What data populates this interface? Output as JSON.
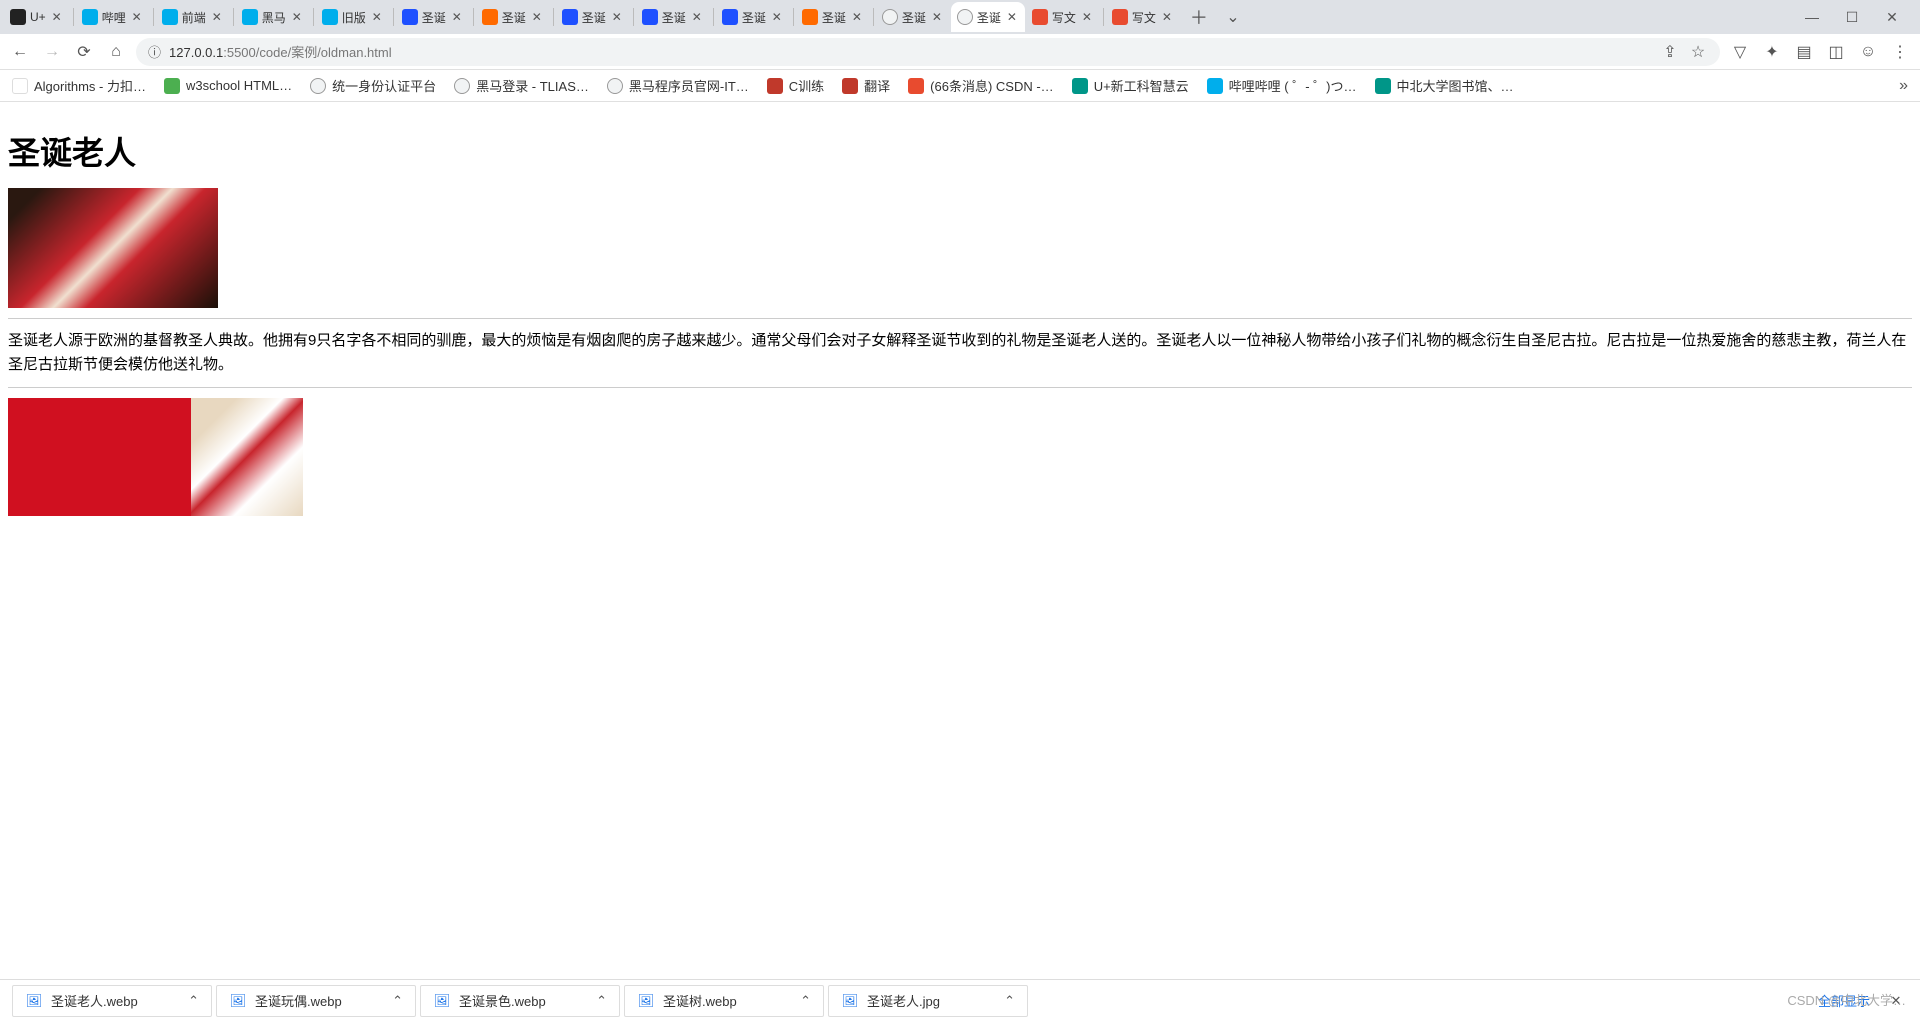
{
  "tabs": [
    {
      "title": "U+",
      "favcls": "fav-black"
    },
    {
      "title": "哔哩",
      "favcls": "fav-blue"
    },
    {
      "title": "前端",
      "favcls": "fav-blue"
    },
    {
      "title": "黑马",
      "favcls": "fav-blue"
    },
    {
      "title": "旧版",
      "favcls": "fav-blue"
    },
    {
      "title": "圣诞",
      "favcls": "fav-bluep"
    },
    {
      "title": "圣诞",
      "favcls": "fav-orange"
    },
    {
      "title": "圣诞",
      "favcls": "fav-bluep"
    },
    {
      "title": "圣诞",
      "favcls": "fav-bluep"
    },
    {
      "title": "圣诞",
      "favcls": "fav-bluep"
    },
    {
      "title": "圣诞",
      "favcls": "fav-orange"
    },
    {
      "title": "圣诞",
      "favcls": "fav-globe"
    },
    {
      "title": "圣诞",
      "favcls": "fav-globe",
      "active": true
    },
    {
      "title": "写文",
      "favcls": "fav-red"
    },
    {
      "title": "写文",
      "favcls": "fav-red"
    }
  ],
  "url": {
    "info_icon": "ⓘ",
    "host": "127.0.0.1",
    "port": ":5500",
    "path": "/code/案例/oldman.html"
  },
  "bookmarks": [
    {
      "label": "Algorithms - 力扣…",
      "favcls": "fav-leet"
    },
    {
      "label": "w3school HTML…",
      "favcls": "fav-green"
    },
    {
      "label": "统一身份认证平台",
      "favcls": "fav-globe"
    },
    {
      "label": "黑马登录 - TLIAS…",
      "favcls": "fav-globe"
    },
    {
      "label": "黑马程序员官网-IT…",
      "favcls": "fav-globe"
    },
    {
      "label": "C训练",
      "favcls": "fav-crimson"
    },
    {
      "label": "翻译",
      "favcls": "fav-crimson"
    },
    {
      "label": "(66条消息) CSDN -…",
      "favcls": "fav-red"
    },
    {
      "label": "U+新工科智慧云",
      "favcls": "fav-teal"
    },
    {
      "label": "哔哩哔哩 ( ゜- ゜)つ…",
      "favcls": "fav-blue"
    },
    {
      "label": "中北大学图书馆、…",
      "favcls": "fav-teal"
    }
  ],
  "page": {
    "heading": "圣诞老人",
    "paragraph": "圣诞老人源于欧洲的基督教圣人典故。他拥有9只名字各不相同的驯鹿，最大的烦恼是有烟囱爬的房子越来越少。通常父母们会对子女解释圣诞节收到的礼物是圣诞老人送的。圣诞老人以一位神秘人物带给小孩子们礼物的概念衍生自圣尼古拉。尼古拉是一位热爱施舍的慈悲主教，荷兰人在圣尼古拉斯节便会模仿他送礼物。"
  },
  "downloads": [
    {
      "name": "圣诞老人.webp"
    },
    {
      "name": "圣诞玩偶.webp"
    },
    {
      "name": "圣诞景色.webp"
    },
    {
      "name": "圣诞树.webp"
    },
    {
      "name": "圣诞老人.jpg"
    }
  ],
  "downloads_showall": "全部显示",
  "watermark": "CSDN @中北大学…"
}
